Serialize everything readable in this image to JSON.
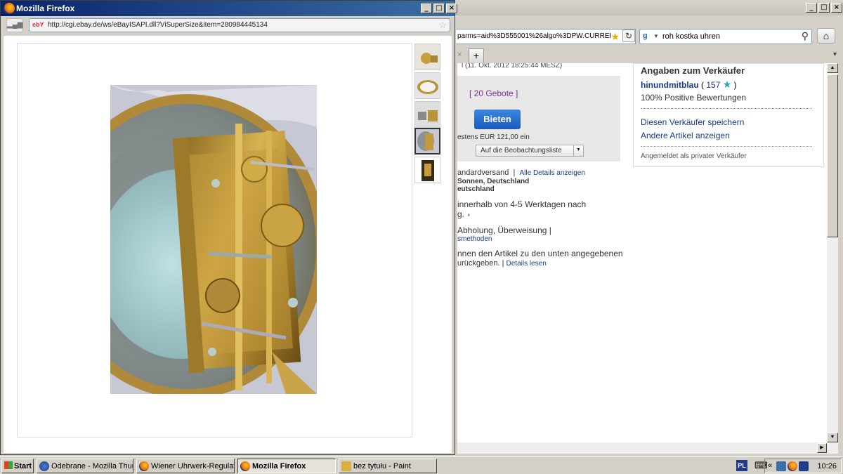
{
  "background_window": {
    "url_text": "parms=aid%3D555001%26algo%3DPW.CURREI",
    "search_text": "roh kostka uhren",
    "listing": {
      "end_time": "l (11. Okt. 2012 18:25:44 MESZ)",
      "bid_count": "[ 20 Gebote ]",
      "bid_button": "Bieten",
      "min_bid": "estens EUR 121,00 ein",
      "watch_button": "Auf die Beobachtungsliste",
      "shipping": "andardversand",
      "all_details": "Alle Details anzeigen",
      "location1": "Sonnen, Deutschland",
      "location2": "eutschland",
      "delivery1": "innerhalb von 4-5 Werktagen nach",
      "delivery2": "g.",
      "payment": "Abholung, Überweisung |",
      "payment_methods": "smethoden",
      "returns1": "nnen den Artikel zu den unten angegebenen",
      "returns2": "urückgeben. |",
      "details_read": "Details lesen"
    },
    "seller": {
      "heading": "Angaben zum Verkäufer",
      "name": "hinundmitblau",
      "score_open": "(",
      "score": "157",
      "score_close": ")",
      "positive": "100% Positive Bewertungen",
      "save_seller": "Diesen Verkäufer speichern",
      "other_items": "Andere Artikel anzeigen",
      "private_note": "Angemeldet als privater Verkäufer"
    }
  },
  "popup": {
    "title": "Mozilla Firefox",
    "url": "http://cgi.ebay.de/ws/eBayISAPI.dll?ViSuperSize&item=280984445134",
    "ebay_logo": "ebY"
  },
  "taskbar": {
    "start": "Start",
    "tasks": [
      {
        "label": "Odebrane - Mozilla Thun..."
      },
      {
        "label": "Wiener Uhrwerk-Regulat..."
      },
      {
        "label": "Mozilla Firefox"
      },
      {
        "label": "bez tytułu - Paint"
      }
    ],
    "lang": "PL",
    "clock": "10:26"
  },
  "colors": {
    "titlebar_active": "#0a246a",
    "bid_button": "#1a5bbf",
    "link": "#1a3a8a",
    "bid_count": "#7a2b9a"
  }
}
